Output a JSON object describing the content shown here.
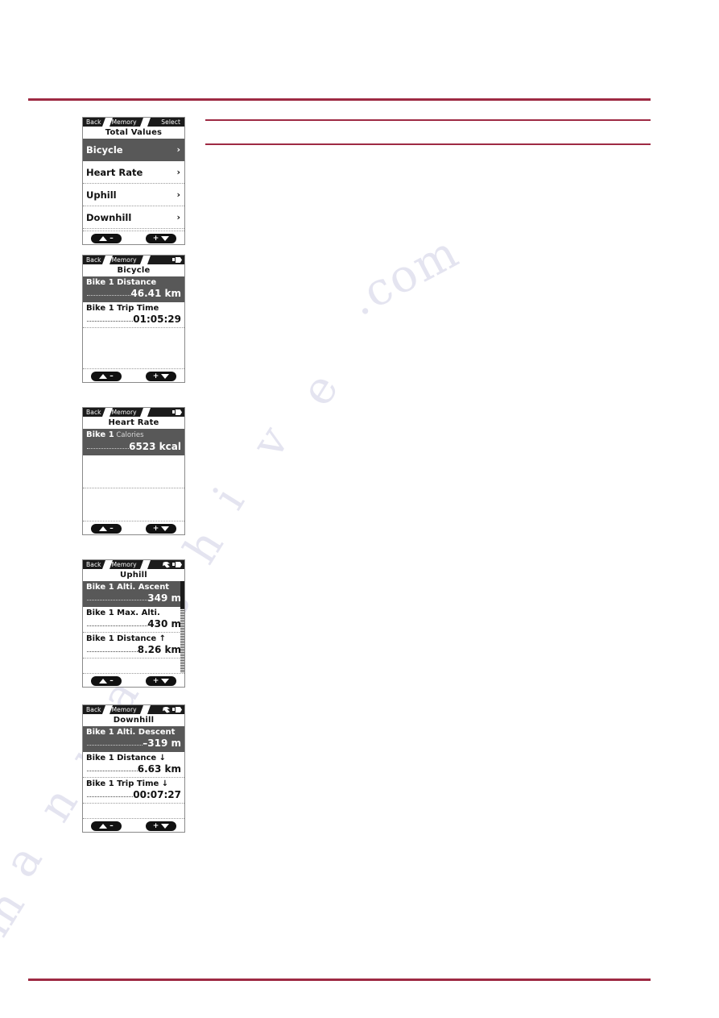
{
  "page": {
    "background": "#ffffff",
    "rule_color": "#9e2a43",
    "watermark": "manualshive.com"
  },
  "screens": [
    {
      "id": "total-values",
      "statusbar": {
        "back": "Back",
        "memory": "Memory",
        "select": "Select",
        "icons": []
      },
      "title": "Total Values",
      "type": "menu",
      "rows": [
        {
          "label": "Bicycle",
          "chevron": "›",
          "selected": true
        },
        {
          "label": "Heart Rate",
          "chevron": "›",
          "selected": false
        },
        {
          "label": "Uphill",
          "chevron": "›",
          "selected": false
        },
        {
          "label": "Downhill",
          "chevron": "›",
          "selected": false
        }
      ],
      "softkeys": {
        "left": "–",
        "right": "+"
      },
      "scrollbar": false
    },
    {
      "id": "bicycle",
      "statusbar": {
        "back": "Back",
        "memory": "Memory",
        "select": "",
        "icons": [
          "battery-icon"
        ]
      },
      "title": "Bicycle",
      "type": "values",
      "rows": [
        {
          "label": "Bike 1 Distance",
          "sub": "",
          "value": "46.41 km",
          "selected": true
        },
        {
          "label": "Bike 1 Trip Time",
          "sub": "",
          "value": "01:05:29",
          "selected": false
        }
      ],
      "empty_rows": 1,
      "softkeys": {
        "left": "–",
        "right": "+"
      },
      "scrollbar": false
    },
    {
      "id": "heart-rate",
      "statusbar": {
        "back": "Back",
        "memory": "Memory",
        "select": "",
        "icons": [
          "battery-icon"
        ]
      },
      "title": "Heart Rate",
      "type": "values",
      "rows": [
        {
          "label": "Bike 1",
          "sub": "Calories",
          "value": "6523 kcal",
          "selected": true
        }
      ],
      "empty_rows": 2,
      "softkeys": {
        "left": "–",
        "right": "+"
      },
      "scrollbar": false
    },
    {
      "id": "uphill",
      "statusbar": {
        "back": "Back",
        "memory": "Memory",
        "select": "",
        "icons": [
          "sensor-icon",
          "battery-icon"
        ]
      },
      "title": "Uphill",
      "type": "values",
      "rows": [
        {
          "label": "Bike 1 Alti. Ascent",
          "sub": "",
          "value": "349 m",
          "selected": true
        },
        {
          "label": "Bike 1 Max. Alti.",
          "sub": "",
          "value": "430 m",
          "selected": false
        },
        {
          "label": "Bike 1 Distance ↑",
          "sub": "",
          "value": "8.26 km",
          "selected": false
        }
      ],
      "empty_rows": 0,
      "softkeys": {
        "left": "–",
        "right": "+"
      },
      "scrollbar": true
    },
    {
      "id": "downhill",
      "statusbar": {
        "back": "Back",
        "memory": "Memory",
        "select": "",
        "icons": [
          "sensor-icon",
          "battery-icon"
        ]
      },
      "title": "Downhill",
      "type": "values",
      "rows": [
        {
          "label": "Bike 1 Alti. Descent",
          "sub": "",
          "value": "–319 m",
          "selected": true
        },
        {
          "label": "Bike 1 Distance ↓",
          "sub": "",
          "value": "6.63 km",
          "selected": false
        },
        {
          "label": "Bike 1 Trip Time ↓",
          "sub": "",
          "value": "00:07:27",
          "selected": false
        }
      ],
      "empty_rows": 0,
      "softkeys": {
        "left": "–",
        "right": "+"
      },
      "scrollbar": false
    }
  ]
}
